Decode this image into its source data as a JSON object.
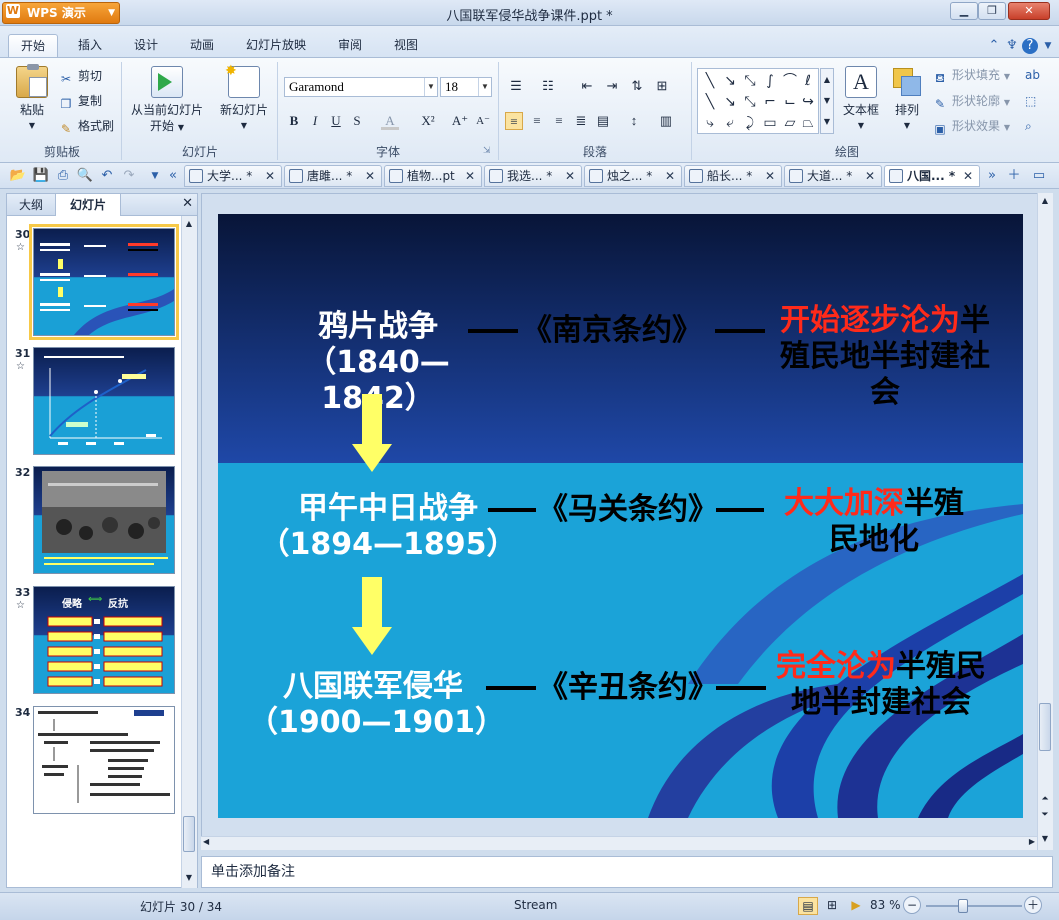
{
  "app": {
    "brand": "WPS 演示",
    "title": "八国联军侵华战争课件.ppt *"
  },
  "menu": {
    "tabs": [
      "开始",
      "插入",
      "设计",
      "动画",
      "幻灯片放映",
      "审阅",
      "视图"
    ]
  },
  "ribbon": {
    "clipboard": {
      "paste": "粘贴",
      "cut": "剪切",
      "copy": "复制",
      "format_brush": "格式刷",
      "label": "剪贴板"
    },
    "slides": {
      "from_current_1": "从当前幻灯片",
      "from_current_2": "开始",
      "new_slide": "新幻灯片",
      "label": "幻灯片"
    },
    "font": {
      "font_name": "Garamond",
      "font_size": "18",
      "label": "字体"
    },
    "paragraph": {
      "label": "段落"
    },
    "drawing": {
      "text_box": "文本框",
      "arrange": "排列",
      "shape_fill": "形状填充",
      "shape_outline": "形状轮廓",
      "shape_effect": "形状效果",
      "label": "绘图"
    }
  },
  "doc_tabs": [
    {
      "label": "大学... *"
    },
    {
      "label": "唐雎... *"
    },
    {
      "label": "植物...pt"
    },
    {
      "label": "我选... *"
    },
    {
      "label": "烛之... *"
    },
    {
      "label": "船长... *"
    },
    {
      "label": "大道... *"
    },
    {
      "label": "八国... *"
    }
  ],
  "left_panel": {
    "tab_outline": "大纲",
    "tab_slides": "幻灯片",
    "thumbnails": [
      {
        "num": "30"
      },
      {
        "num": "31"
      },
      {
        "num": "32"
      },
      {
        "num": "33",
        "t1": "侵略",
        "t2": "反抗"
      },
      {
        "num": "34"
      }
    ]
  },
  "slide": {
    "rows": [
      {
        "war": "鸦片战争",
        "years": "（1840—1842）",
        "treaty": "《南京条约》",
        "red": "开始逐步沦为",
        "black": "半殖民地半封建社会"
      },
      {
        "war": "甲午中日战争",
        "years": "（1894—1895）",
        "treaty": "《马关条约》",
        "red": "大大加深",
        "black": "半殖民地化"
      },
      {
        "war": "八国联军侵华",
        "years": "（1900—1901）",
        "treaty": "《辛丑条约》",
        "red": "完全沦为",
        "black": "半殖民地半封建社会"
      }
    ]
  },
  "notes": {
    "placeholder": "单击添加备注"
  },
  "status": {
    "slide_info": "幻灯片 30 / 34",
    "theme": "Stream",
    "zoom": "83 %"
  },
  "colors": {
    "accent_red": "#ff2a1a",
    "arrow_yellow": "#ffff66",
    "slide_top": "#0b1e4e",
    "slide_bottom": "#1aa0d6"
  }
}
